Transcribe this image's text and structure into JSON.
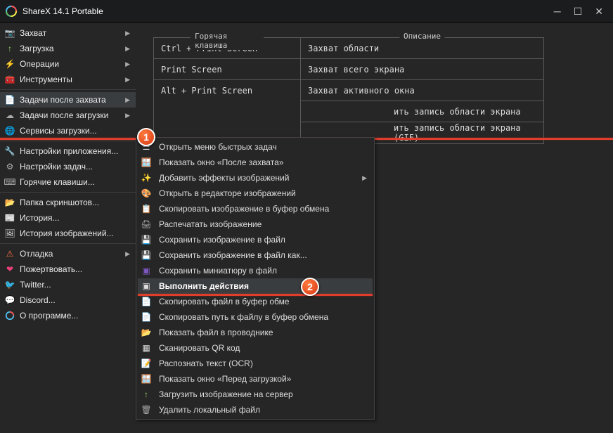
{
  "window": {
    "title": "ShareX 14.1 Portable"
  },
  "sidebar": {
    "items": [
      {
        "label": "Захват",
        "arrow": true
      },
      {
        "label": "Загрузка",
        "arrow": true
      },
      {
        "label": "Операции",
        "arrow": true
      },
      {
        "label": "Инструменты",
        "arrow": true
      }
    ],
    "items2": [
      {
        "label": "Задачи после захвата",
        "arrow": true,
        "hl": true
      },
      {
        "label": "Задачи после загрузки",
        "arrow": true
      },
      {
        "label": "Сервисы загрузки...",
        "arrow": false
      }
    ],
    "items3": [
      {
        "label": "Настройки приложения...",
        "arrow": false
      },
      {
        "label": "Настройки задач...",
        "arrow": false
      },
      {
        "label": "Горячие клавиши...",
        "arrow": false
      }
    ],
    "items4": [
      {
        "label": "Папка скриншотов...",
        "arrow": false
      },
      {
        "label": "История...",
        "arrow": false
      },
      {
        "label": "История изображений...",
        "arrow": false
      }
    ],
    "items5": [
      {
        "label": "Отладка",
        "arrow": true
      },
      {
        "label": "Пожертвовать...",
        "arrow": false
      },
      {
        "label": "Twitter...",
        "arrow": false
      },
      {
        "label": "Discord...",
        "arrow": false
      },
      {
        "label": "О программе...",
        "arrow": false
      }
    ]
  },
  "table": {
    "hotkey_header": "Горячая клавиша",
    "desc_header": "Описание",
    "rows": [
      {
        "hotkey": "Ctrl + Print Screen",
        "desc": "Захват области"
      },
      {
        "hotkey": "Print Screen",
        "desc": "Захват всего экрана"
      },
      {
        "hotkey": "Alt + Print Screen",
        "desc": "Захват активного окна"
      },
      {
        "hotkey": "",
        "desc": "ить запись области экрана"
      },
      {
        "hotkey": "",
        "desc": "ить запись области экрана (GIF)"
      }
    ]
  },
  "submenu": {
    "items": [
      {
        "label": "Открыть меню быстрых задач"
      },
      {
        "label": "Показать окно «После захвата»"
      },
      {
        "label": "Добавить эффекты изображений",
        "arrow": true
      },
      {
        "label": "Открыть в редакторе изображений"
      },
      {
        "label": "Скопировать изображение в буфер обмена"
      },
      {
        "label": "Распечатать изображение"
      },
      {
        "label": "Сохранить изображение в файл"
      },
      {
        "label": "Сохранить изображение в файл как..."
      },
      {
        "label": "Сохранить миниатюру в файл"
      },
      {
        "label": "Выполнить действия",
        "bold": true,
        "hl": true
      },
      {
        "label": "Скопировать файл в буфер обме"
      },
      {
        "label": "Скопировать путь к файлу в буфер обмена"
      },
      {
        "label": "Показать файл в проводнике"
      },
      {
        "label": "Сканировать QR код"
      },
      {
        "label": "Распознать текст (OCR)"
      },
      {
        "label": "Показать окно «Перед загрузкой»"
      },
      {
        "label": "Загрузить изображение на сервер"
      },
      {
        "label": "Удалить локальный файл"
      }
    ]
  },
  "callouts": {
    "one": "1",
    "two": "2"
  }
}
